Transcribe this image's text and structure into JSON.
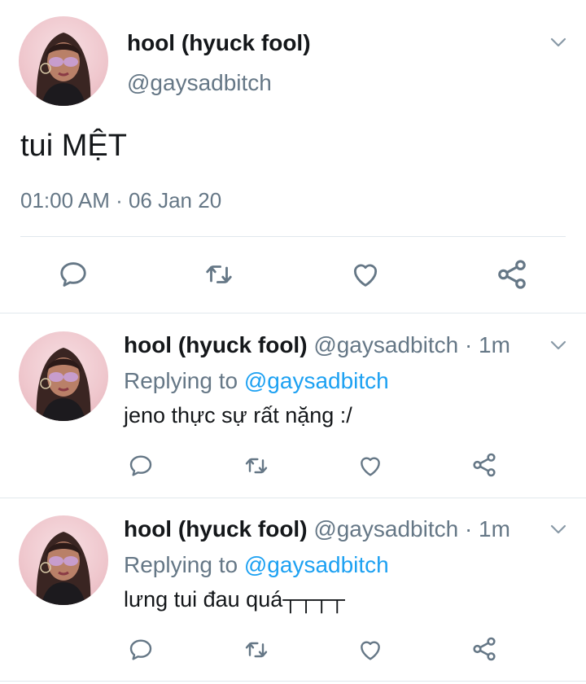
{
  "main_tweet": {
    "display_name": "hool (hyuck fool)",
    "handle": "@gaysadbitch",
    "text": "tui MỆT",
    "timestamp": "01:00 AM · 06 Jan 20"
  },
  "replies": [
    {
      "display_name": "hool (hyuck fool)",
      "meta": "@gaysadbitch · 1m",
      "replying_prefix": "Replying to",
      "replying_to": "@gaysadbitch",
      "text": "jeno thực sự rất nặng :/"
    },
    {
      "display_name": "hool (hyuck fool)",
      "meta": "@gaysadbitch · 1m",
      "replying_prefix": "Replying to",
      "replying_to": "@gaysadbitch",
      "text": "lưng tui đau quá┬┬┬┬"
    }
  ],
  "icons": {
    "reply": "reply-icon",
    "retweet": "retweet-icon",
    "like": "heart-icon",
    "share": "share-icon",
    "menu": "chevron-down-icon"
  },
  "colors": {
    "text": "#14171a",
    "muted": "#657786",
    "link": "#1da1f2",
    "icon": "#657786",
    "divider": "#e1e8ed",
    "avatar_bg": "#efc7cd"
  }
}
